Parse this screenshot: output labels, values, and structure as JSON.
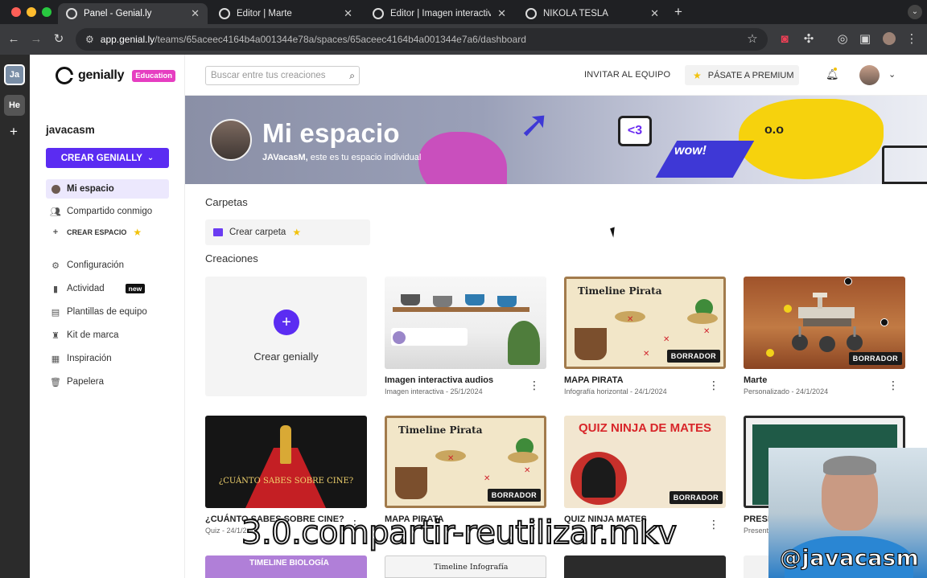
{
  "browser": {
    "tabs": [
      {
        "title": "Panel - Genial.ly",
        "active": true
      },
      {
        "title": "Editor | Marte",
        "active": false
      },
      {
        "title": "Editor | Imagen interactiva au",
        "active": false
      },
      {
        "title": "NIKOLA TESLA",
        "active": false
      }
    ],
    "new_tab": "+",
    "url_host": "app.genial.ly",
    "url_path": "/teams/65aceec4164b4a001344e78a/spaces/65aceec4164b4a001344e7a6/dashboard"
  },
  "rail": {
    "workspaces": [
      {
        "initials": "Ja",
        "color": "#7a8ea6"
      },
      {
        "initials": "He",
        "color": "#555555"
      }
    ],
    "add": "+"
  },
  "sidebar": {
    "logo_word": "genially",
    "logo_badge": "Education",
    "user": "javacasm",
    "create_button": "CREAR GENIALLY",
    "items": [
      {
        "label": "Mi espacio",
        "icon": "user-icon",
        "active": true
      },
      {
        "label": "Compartido conmigo",
        "icon": "people-icon"
      },
      {
        "label": "CREAR ESPACIO",
        "icon": "plus-icon",
        "small": true
      },
      {
        "label": "Configuración",
        "icon": "gear-icon"
      },
      {
        "label": "Actividad",
        "icon": "bar-chart-icon",
        "badge": "new"
      },
      {
        "label": "Plantillas de equipo",
        "icon": "template-icon"
      },
      {
        "label": "Kit de marca",
        "icon": "brand-icon"
      },
      {
        "label": "Inspiración",
        "icon": "inspiration-icon"
      },
      {
        "label": "Papelera",
        "icon": "trash-icon"
      }
    ]
  },
  "topbar": {
    "search_placeholder": "Buscar entre tus creaciones",
    "invite": "INVITAR AL EQUIPO",
    "premium": "PÁSATE A PREMIUM"
  },
  "hero": {
    "title": "Mi espacio",
    "subtitle_name": "JAVacasM,",
    "subtitle_rest": " este es tu espacio individual",
    "deco_speech": "<3",
    "deco_wow": "wow!",
    "deco_face": "o.o"
  },
  "folders": {
    "title": "Carpetas",
    "create": "Crear carpeta"
  },
  "creations": {
    "title": "Creaciones",
    "create_label": "Crear genially",
    "draft_label": "BORRADOR",
    "items": [
      {
        "title": "Imagen interactiva audios",
        "meta": "Imagen interactiva - 25/1/2024",
        "draft": false,
        "thumb": "kitchen"
      },
      {
        "title": "MAPA PIRATA",
        "meta": "Infografía horizontal - 24/1/2024",
        "draft": true,
        "thumb": "pirate",
        "thumb_title": "Timeline Pirata"
      },
      {
        "title": "Marte",
        "meta": "Personalizado - 24/1/2024",
        "draft": true,
        "thumb": "mars"
      },
      {
        "title": "¿CUÁNTO SABES SOBRE CINE?",
        "meta": "Quiz - 24/1/2",
        "draft": false,
        "thumb": "cinema",
        "thumb_title": "¿CUÁNTO SABES SOBRE CINE?"
      },
      {
        "title": "MAPA PIRATA",
        "meta": "",
        "draft": true,
        "thumb": "pirate",
        "thumb_title": "Timeline Pirata"
      },
      {
        "title": "QUIZ NINJA MATES",
        "meta": "",
        "draft": true,
        "thumb": "ninja",
        "thumb_title": "QUIZ NINJA DE MATES"
      },
      {
        "title": "PRESE",
        "meta": "Present",
        "draft": false,
        "thumb": "chalk"
      }
    ],
    "row3_titles": [
      "TIMELINE BIOLOGÍA",
      "Timeline Infografía"
    ]
  },
  "video_overlay": {
    "filename": "3.0.compartir-reutilizar.mkv",
    "handle": "@javacasm"
  }
}
